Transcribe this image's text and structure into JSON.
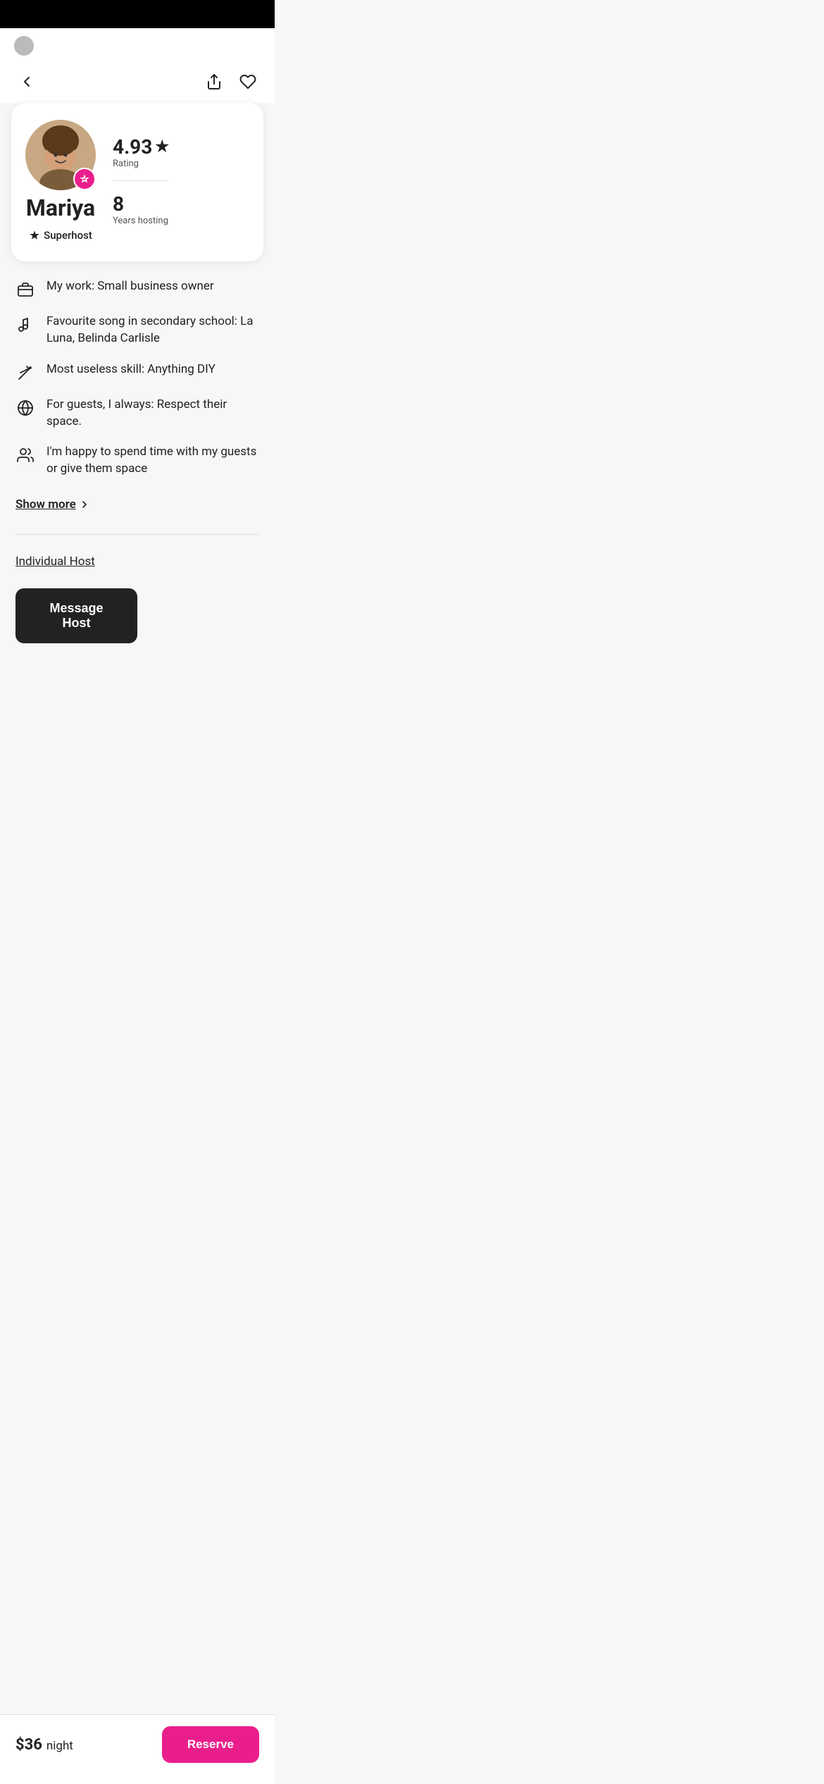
{
  "statusBar": {
    "dotColor": "#bbb"
  },
  "nav": {
    "backLabel": "Back",
    "shareLabel": "Share",
    "favoriteLabel": "Favorite"
  },
  "profile": {
    "name": "Mariya",
    "superhostLabel": "Superhost",
    "rating": "4.93",
    "ratingLabel": "Rating",
    "yearsHosting": "8",
    "yearsHostingLabel": "Years hosting"
  },
  "infoItems": [
    {
      "icon": "briefcase",
      "text": "My work: Small business owner"
    },
    {
      "icon": "music",
      "text": "Favourite song in secondary school: La Luna, Belinda Carlisle"
    },
    {
      "icon": "wand",
      "text": "Most useless skill: Anything DIY"
    },
    {
      "icon": "dish",
      "text": "For guests, I always: Respect their space."
    },
    {
      "icon": "people",
      "text": "I'm happy to spend time with my guests or give them space"
    }
  ],
  "showMore": {
    "label": "Show more"
  },
  "individualHost": {
    "label": "Individual Host"
  },
  "messageHost": {
    "label": "Message Host"
  },
  "bottomBar": {
    "priceAmount": "$36",
    "pricePeriod": "night",
    "reserveLabel": "Reserve"
  }
}
